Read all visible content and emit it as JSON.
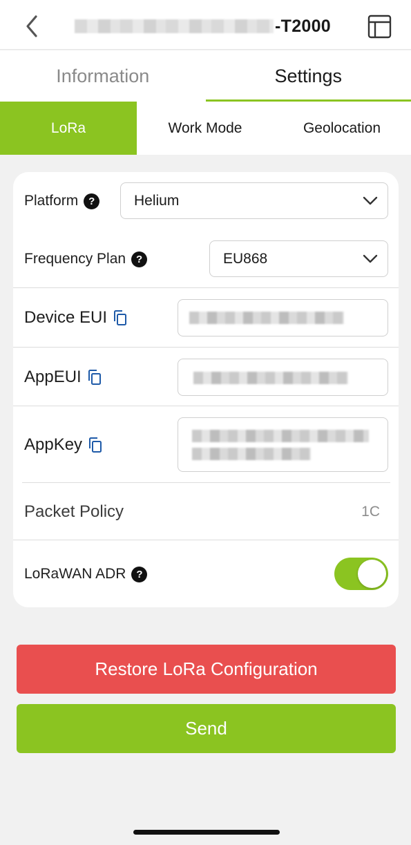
{
  "header": {
    "title_suffix": "-T2000",
    "back_icon": "chevron-left-icon",
    "layout_icon": "layout-panel-icon"
  },
  "main_tabs": [
    {
      "label": "Information",
      "active": false
    },
    {
      "label": "Settings",
      "active": true
    }
  ],
  "sub_tabs": [
    {
      "label": "LoRa",
      "active": true
    },
    {
      "label": "Work Mode",
      "active": false
    },
    {
      "label": "Geolocation",
      "active": false
    }
  ],
  "form": {
    "platform": {
      "label": "Platform",
      "value": "Helium"
    },
    "frequency_plan": {
      "label": "Frequency Plan",
      "value": "EU868"
    },
    "device_eui": {
      "label": "Device EUI"
    },
    "app_eui": {
      "label": "AppEUI"
    },
    "app_key": {
      "label": "AppKey"
    },
    "packet_policy": {
      "label": "Packet Policy",
      "value": "1C"
    },
    "adr": {
      "label": "LoRaWAN ADR",
      "enabled": true
    }
  },
  "actions": {
    "restore_label": "Restore LoRa Configuration",
    "send_label": "Send"
  },
  "colors": {
    "accent": "#8bc421",
    "danger": "#e94f4f",
    "background": "#f1f1f1"
  }
}
